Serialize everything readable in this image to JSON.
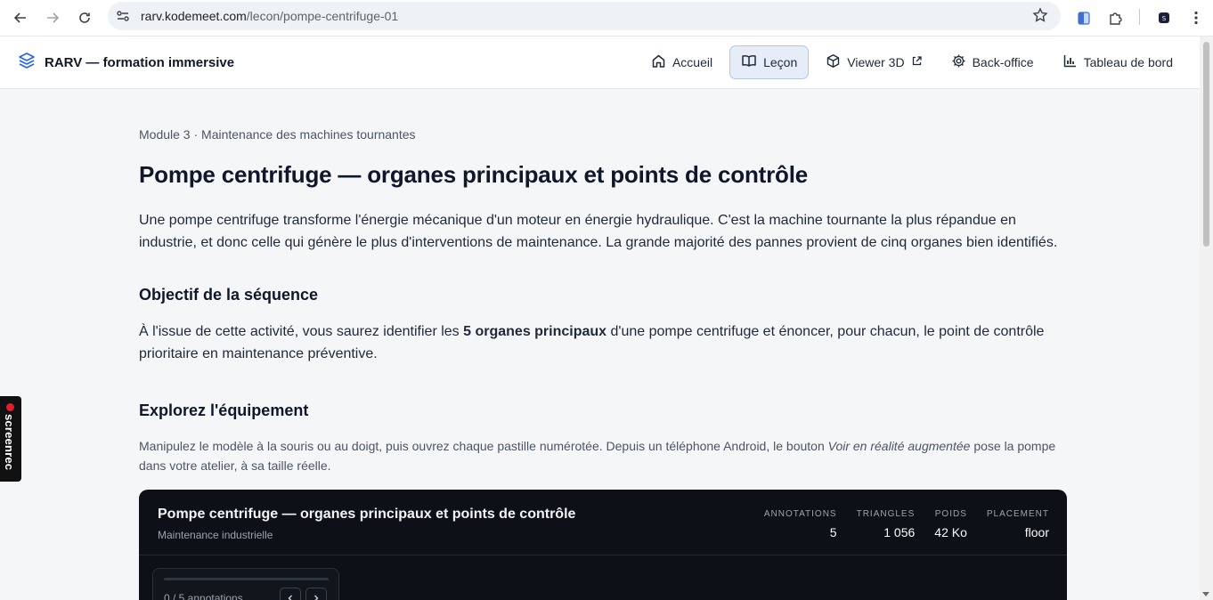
{
  "browser": {
    "url_host": "rarv.kodemeet.com",
    "url_path": "/lecon/pompe-centrifuge-01"
  },
  "app": {
    "brand": "RARV — formation immersive",
    "nav": [
      {
        "label": "Accueil",
        "icon": "home-icon",
        "active": false
      },
      {
        "label": "Leçon",
        "icon": "book-icon",
        "active": true
      },
      {
        "label": "Viewer 3D",
        "icon": "cube-icon",
        "active": false
      },
      {
        "label": "Back-office",
        "icon": "gear-icon",
        "active": false
      },
      {
        "label": "Tableau de bord",
        "icon": "bar-chart-icon",
        "active": false
      }
    ]
  },
  "lesson": {
    "breadcrumb": "Module 3 · Maintenance des machines tournantes",
    "title": "Pompe centrifuge — organes principaux et points de contrôle",
    "intro": "Une pompe centrifuge transforme l'énergie mécanique d'un moteur en énergie hydraulique. C'est la machine tournante la plus répandue en industrie, et donc celle qui génère le plus d'interventions de maintenance. La grande majorité des pannes provient de cinq organes bien identifiés.",
    "objective_heading": "Objectif de la séquence",
    "objective_before": "À l'issue de cette activité, vous saurez identifier les ",
    "objective_bold": "5 organes principaux",
    "objective_after": " d'une pompe centrifuge et énoncer, pour chacun, le point de contrôle prioritaire en maintenance préventive.",
    "explore_heading": "Explorez l'équipement",
    "explore_before": "Manipulez le modèle à la souris ou au doigt, puis ouvrez chaque pastille numérotée. Depuis un téléphone Android, le bouton ",
    "explore_italic": "Voir en réalité augmentée",
    "explore_after": " pose la pompe dans votre atelier, à sa taille réelle."
  },
  "viewer": {
    "title": "Pompe centrifuge — organes principaux et points de contrôle",
    "subtitle": "Maintenance industrielle",
    "stats": [
      {
        "label": "ANNOTATIONS",
        "value": "5"
      },
      {
        "label": "TRIANGLES",
        "value": "1 056"
      },
      {
        "label": "POIDS",
        "value": "42 Ko"
      },
      {
        "label": "PLACEMENT",
        "value": "floor"
      }
    ],
    "annotation_count": "0 / 5 annotations",
    "progress": 0
  },
  "overlay": {
    "screenrec": "screenrec"
  }
}
